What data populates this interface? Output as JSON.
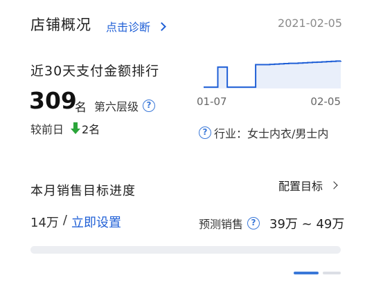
{
  "header": {
    "title": "店铺概况",
    "diagnose_link": "点击诊断",
    "date": "2021-02-05"
  },
  "ranking": {
    "title": "近30天支付金额排行",
    "rank": "309",
    "unit": "名",
    "tier": "第六层级",
    "compare_label": "较前日",
    "compare_value": "2名",
    "compare_direction": "down",
    "compare_color": "#2ba53a",
    "chart_x_start": "01-07",
    "chart_x_end": "02-05",
    "industry": "行业：女士内衣/男士内"
  },
  "chart_data": {
    "type": "area",
    "x": [
      "01-07",
      "02-05"
    ],
    "values": [
      5,
      5,
      5,
      85,
      85,
      5,
      5,
      5,
      5,
      5,
      5,
      95,
      95,
      95,
      96,
      97,
      98,
      99,
      100,
      100,
      101,
      102,
      103,
      104,
      105,
      106,
      107,
      108,
      109,
      110
    ],
    "color": "#1f5fd6",
    "fill": "#e9effa"
  },
  "sales": {
    "title": "本月销售目标进度",
    "config_label": "配置目标",
    "current": "14万",
    "separator": "/",
    "set_link": "立即设置",
    "forecast_label": "预测销售",
    "forecast_range": "39万 ~ 49万",
    "progress": 0
  },
  "pager": {
    "active_color": "#3a78d8",
    "inactive_color": "#dcdfe5"
  }
}
